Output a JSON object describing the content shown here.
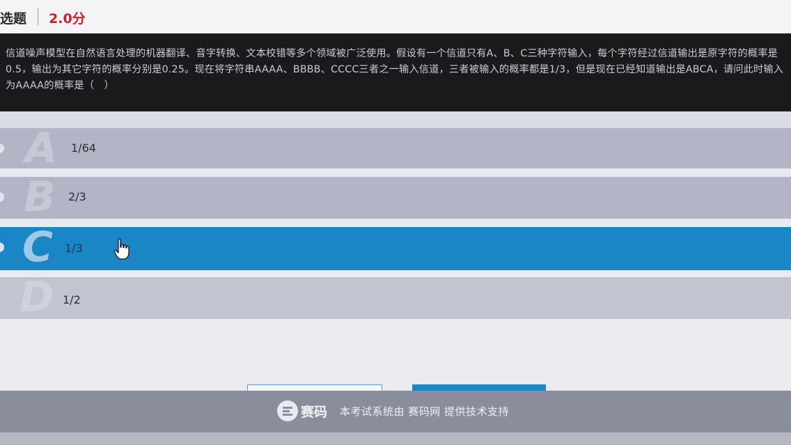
{
  "header": {
    "question_type": "选题",
    "score": "2.0分"
  },
  "question": {
    "text": "信道噪声模型在自然语言处理的机器翻译、音字转换、文本校错等多个领域被广泛使用。假设有一个信道只有A、B、C三种字符输入，每个字符经过信道输出是原字符的概率是0.5，输出为其它字符的概率分别是0.25。现在将字符串AAAA、BBBB、CCCC三者之一输入信道，三者被输入的概率都是1/3，但是现在已经知道输出是ABCA，请问此时输入为AAAA的概率是（　）"
  },
  "options": [
    {
      "letter": "A",
      "text": "1/64",
      "selected": false
    },
    {
      "letter": "B",
      "text": "2/3",
      "selected": false
    },
    {
      "letter": "C",
      "text": "1/3",
      "selected": true
    },
    {
      "letter": "D",
      "text": "1/2",
      "selected": false
    }
  ],
  "footer": {
    "brand": "赛码",
    "support_text": "本考试系统由 赛码网 提供技术支持"
  },
  "colors": {
    "score": "#c8222a",
    "selected": "#1a86c6",
    "option_bg": "#b3b5c7",
    "question_bg": "#1a1a1c"
  },
  "icons": [
    "radio-icon",
    "saima-logo-icon",
    "hand-pointer-icon"
  ]
}
